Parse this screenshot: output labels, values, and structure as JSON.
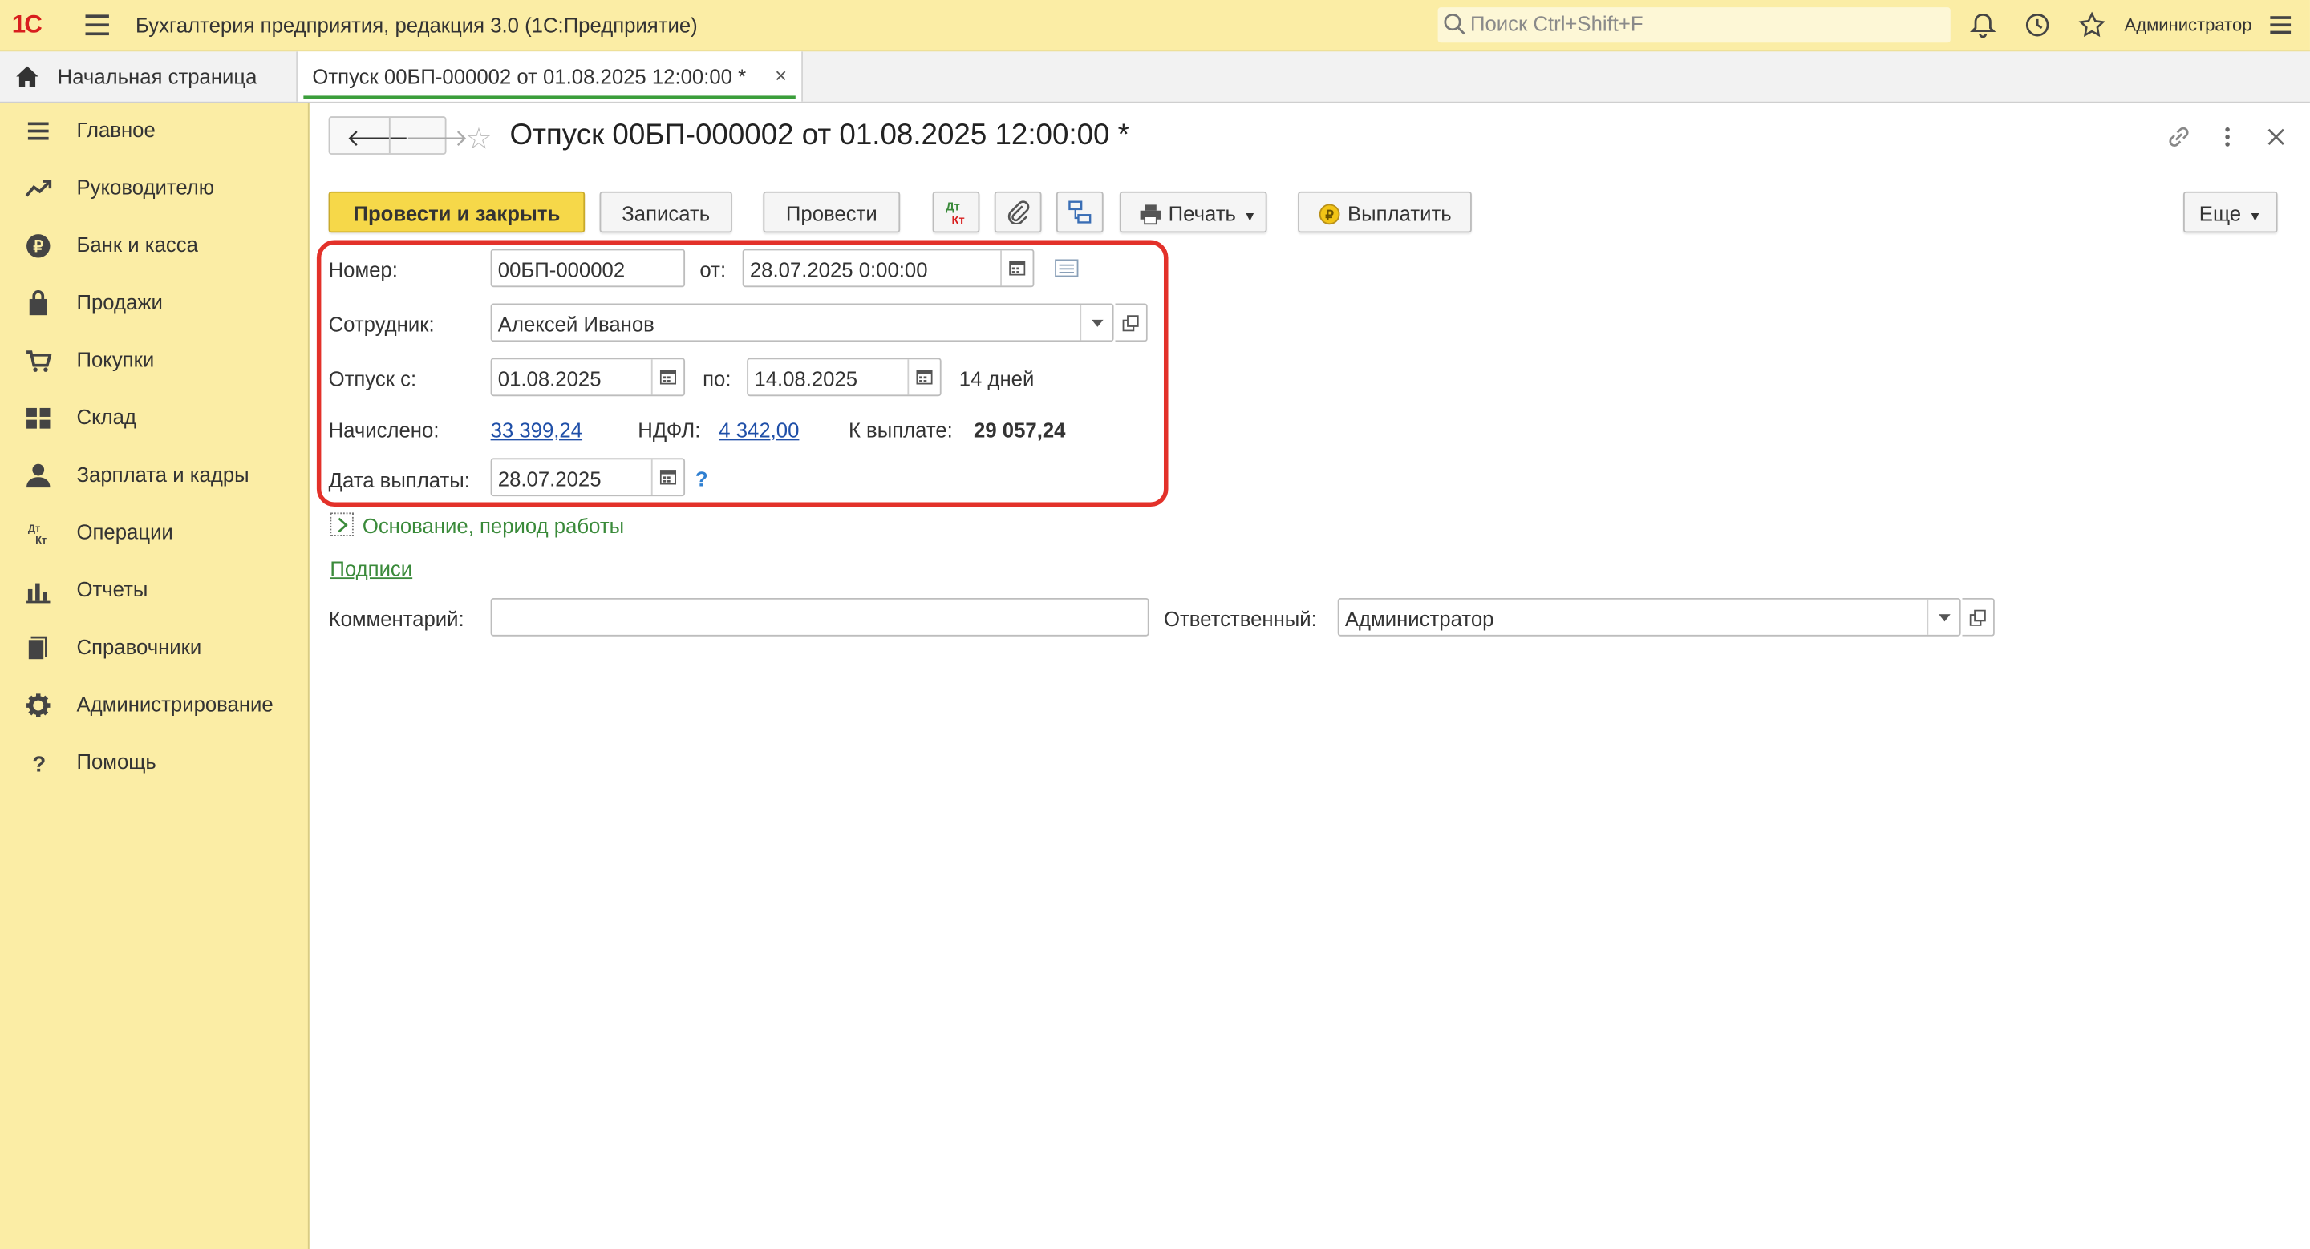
{
  "app": {
    "logo": "1С",
    "title": "Бухгалтерия предприятия, редакция 3.0  (1С:Предприятие)",
    "search_placeholder": "Поиск Ctrl+Shift+F",
    "user": "Администратор"
  },
  "tabs": {
    "home": "Начальная страница",
    "document": "Отпуск 00БП-000002 от 01.08.2025 12:00:00 *",
    "close": "×"
  },
  "sidebar": {
    "items": [
      {
        "label": "Главное",
        "icon": "menu-icon"
      },
      {
        "label": "Руководителю",
        "icon": "trend-icon"
      },
      {
        "label": "Банк и касса",
        "icon": "ruble-icon"
      },
      {
        "label": "Продажи",
        "icon": "bag-icon"
      },
      {
        "label": "Покупки",
        "icon": "cart-icon"
      },
      {
        "label": "Склад",
        "icon": "warehouse-icon"
      },
      {
        "label": "Зарплата и кадры",
        "icon": "person-icon"
      },
      {
        "label": "Операции",
        "icon": "dt-kt-icon"
      },
      {
        "label": "Отчеты",
        "icon": "bar-chart-icon"
      },
      {
        "label": "Справочники",
        "icon": "book-icon"
      },
      {
        "label": "Администрирование",
        "icon": "gear-icon"
      },
      {
        "label": "Помощь",
        "icon": "help-icon"
      }
    ]
  },
  "form": {
    "title": "Отпуск 00БП-000002 от 01.08.2025 12:00:00 *",
    "toolbar": {
      "post_close": "Провести и закрыть",
      "save": "Записать",
      "post": "Провести",
      "print": "Печать",
      "pay": "Выплатить",
      "more": "Еще"
    },
    "number_label": "Номер:",
    "number_value": "00БП-000002",
    "from_label": "от:",
    "from_value": "28.07.2025  0:00:00",
    "employee_label": "Сотрудник:",
    "employee_value": "Алексей Иванов",
    "vacation_from_label": "Отпуск с:",
    "vacation_from_value": "01.08.2025",
    "vacation_to_label": "по:",
    "vacation_to_value": "14.08.2025",
    "days": "14 дней",
    "accrued_label": "Начислено:",
    "accrued_value": "33 399,24",
    "ndfl_label": "НДФЛ:",
    "ndfl_value": "4 342,00",
    "payout_label": "К выплате:",
    "payout_value": "29 057,24",
    "pay_date_label": "Дата выплаты:",
    "pay_date_value": "28.07.2025",
    "help_mark": "?",
    "basis_link": "Основание, период работы",
    "signatures_link": "Подписи",
    "comment_label": "Комментарий:",
    "comment_value": "",
    "responsible_label": "Ответственный:",
    "responsible_value": "Администратор"
  },
  "colors": {
    "panel_yellow": "#fbeda5",
    "primary_button": "#f6d849",
    "highlight_red": "#e3312a",
    "link_blue": "#1f4fa8",
    "link_green": "#3a8a3a"
  }
}
